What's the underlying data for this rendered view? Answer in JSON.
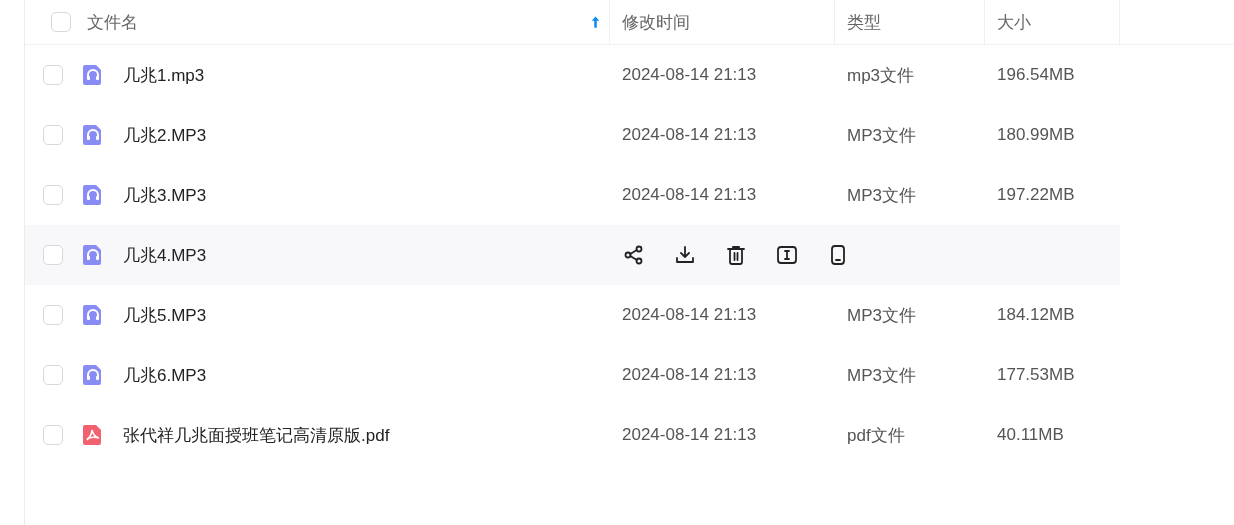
{
  "table": {
    "select_all": {
      "checked": false
    },
    "sort_ascending": true,
    "columns": [
      "文件名",
      "修改时间",
      "类型",
      "大小"
    ],
    "rows": [
      {
        "kind": "audio",
        "name": "几兆1.mp3",
        "modified": "2024-08-14 21:13",
        "type": "mp3文件",
        "size": "196.54MB",
        "checked": false,
        "hovered": false
      },
      {
        "kind": "audio",
        "name": "几兆2.MP3",
        "modified": "2024-08-14 21:13",
        "type": "MP3文件",
        "size": "180.99MB",
        "checked": false,
        "hovered": false
      },
      {
        "kind": "audio",
        "name": "几兆3.MP3",
        "modified": "2024-08-14 21:13",
        "type": "MP3文件",
        "size": "197.22MB",
        "checked": false,
        "hovered": false
      },
      {
        "kind": "audio",
        "name": "几兆4.MP3",
        "checked": false,
        "hovered": true
      },
      {
        "kind": "audio",
        "name": "几兆5.MP3",
        "modified": "2024-08-14 21:13",
        "type": "MP3文件",
        "size": "184.12MB",
        "checked": false,
        "hovered": false
      },
      {
        "kind": "audio",
        "name": "几兆6.MP3",
        "modified": "2024-08-14 21:13",
        "type": "MP3文件",
        "size": "177.53MB",
        "checked": false,
        "hovered": false
      },
      {
        "kind": "pdf",
        "name": "张代祥几兆面授班笔记高清原版.pdf",
        "modified": "2024-08-14 21:13",
        "type": "pdf文件",
        "size": "40.11MB",
        "checked": false,
        "hovered": false
      }
    ]
  }
}
